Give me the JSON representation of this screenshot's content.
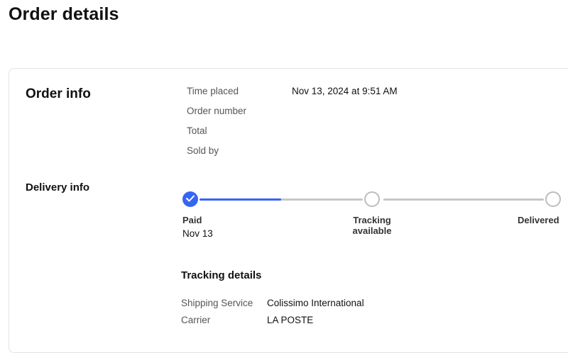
{
  "page": {
    "title": "Order details"
  },
  "order_info": {
    "title": "Order info",
    "rows": [
      {
        "label": "Time placed",
        "value": "Nov 13, 2024 at 9:51 AM"
      },
      {
        "label": "Order number",
        "value": ""
      },
      {
        "label": "Total",
        "value": ""
      },
      {
        "label": "Sold by",
        "value": ""
      }
    ]
  },
  "delivery_info": {
    "title": "Delivery info",
    "steps": [
      {
        "label": "Paid",
        "date": "Nov 13",
        "status": "done"
      },
      {
        "label": "Tracking\navailable",
        "status": "pending"
      },
      {
        "label": "Delivered",
        "status": "pending"
      }
    ],
    "progress": 0.25
  },
  "tracking_details": {
    "title": "Tracking details",
    "rows": [
      {
        "label": "Shipping Service",
        "value": "Colissimo International"
      },
      {
        "label": "Carrier",
        "value": "LA POSTE"
      }
    ]
  },
  "colors": {
    "accent": "#3665f3",
    "track": "#c7c7c7",
    "step_border": "#bdbdbd"
  },
  "icons": {
    "done_step": "check-icon"
  }
}
